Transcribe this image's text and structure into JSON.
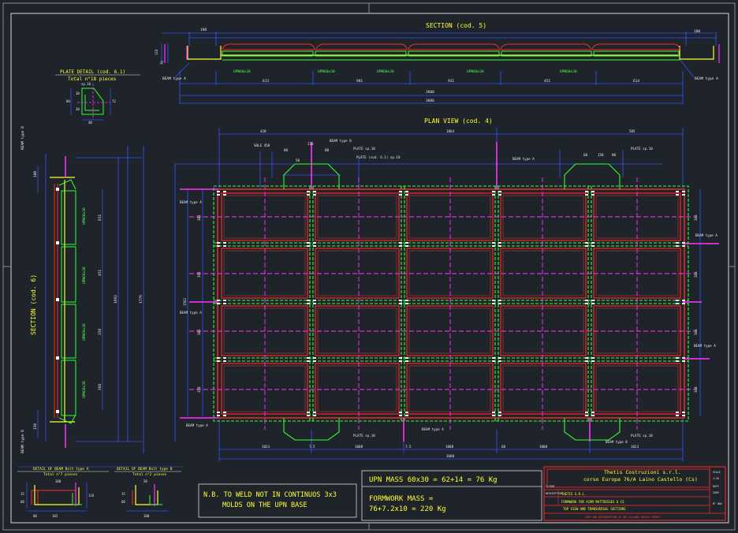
{
  "section5": {
    "title": "SECTION (cod. 5)",
    "dims_top": [
      "180",
      "180"
    ],
    "labels": [
      "UPN60x30",
      "UPN60x30",
      "UPN60x30",
      "UPN60x30",
      "UPN60x30"
    ],
    "dims_bottom": [
      "613",
      "901",
      "931",
      "451",
      "614"
    ],
    "total": "3600",
    "total2": "3686",
    "beam_left": "BEAM type A",
    "beam_right": "BEAM type A",
    "side_dims": [
      "110",
      "70"
    ]
  },
  "plate_detail": {
    "title": "PLATE DETAIL (cod. 6.1)",
    "subtitle": "Total n°18 pieces",
    "dims": [
      "sp.10",
      "80",
      "72",
      "40",
      "30",
      "30"
    ]
  },
  "section6": {
    "title": "SECTION (cod. 6)",
    "beam_top": "BEAM type B",
    "beam_bottom": "BEAM type B",
    "labels": [
      "UPN60x30",
      "UPN60x30",
      "UPN60x30",
      "UPN60x30"
    ],
    "dims": [
      "811",
      "451",
      "258",
      "268",
      "1693",
      "1779",
      "180",
      "150"
    ]
  },
  "plan": {
    "title": "PLAN VIEW (cod. 4)",
    "dims_top": [
      "420",
      "1864",
      "505"
    ],
    "notes": [
      "BEAM type B",
      "SOLE 450",
      "PLATE sp.10",
      "PLATE (cod. 6.1) sp.10",
      "BEAM type A",
      "PLATE sp.10",
      "BEAM type A",
      "BEAM type A",
      "BEAM type A",
      "BEAM type A",
      "PLATE sp.10",
      "BEAM type A",
      "PLATE sp.10",
      "BEAM type B",
      "BEAM type A"
    ],
    "top_small_dims": [
      "80",
      "210",
      "80",
      "50",
      "60",
      "150",
      "80"
    ],
    "dims_right": [
      "388",
      "388",
      "388",
      "388"
    ],
    "dims_left": [
      "1562",
      "381",
      "391",
      "381",
      "378"
    ],
    "dims_bottom": [
      "1023",
      "1008",
      "1008",
      "1008",
      "1023"
    ],
    "total_bottom": "3600",
    "small_bottom": [
      "7.5",
      "7.5",
      "60"
    ]
  },
  "beam_a": {
    "title": "DETAIL OF BEAM Bolt type A",
    "subtitle": "Total n°7 pieces",
    "dims": [
      "100",
      "15",
      "60",
      "182",
      "80",
      "116"
    ]
  },
  "beam_b": {
    "title": "DETAIL OF BEAM Bolt type B",
    "subtitle": "Total n°2 pieces",
    "dims": [
      "50",
      "15",
      "60",
      "100"
    ]
  },
  "note": {
    "line1": "N.B. TO WELD NOT IN CONTINUOS 3x3",
    "line2": "MOLDS ON THE UPN BASE"
  },
  "mass": {
    "line1": "UPN MASS 60x30 = 62+14 = 76 Kg",
    "line2": "FORMWORK MASS =",
    "line3": "76+7.2x10 = 220 Kg"
  },
  "titleblock": {
    "company": "Thetis Costruzioni s.r.l.",
    "address": "corso Europa 76/A    Laino Castello (Cs)",
    "client_label": "CLIENT",
    "client": "THETIS S.R.L.",
    "desc_label": "DESCRIPTION",
    "desc": "FORMWORK FOR ACRM MATTRESSES 6 CS",
    "drawing": "TOP VIEW AND TRANSVERSAL SECTIONS",
    "footer": "COPY AND REPRODUCTION IS NOT ALLOWED UNLESS PERMIT",
    "side_cells": [
      "SCALE",
      "1:20",
      "DATE",
      "2009",
      "N° 000"
    ]
  },
  "colors": {
    "bg": "#1f242b",
    "green": "#33ff33",
    "red": "#ff2a2a",
    "blue": "#2f55ff",
    "magenta": "#ff33ff",
    "yellow": "#ffff33",
    "cyan": "#00e5ff",
    "white": "#e8e8e8"
  }
}
